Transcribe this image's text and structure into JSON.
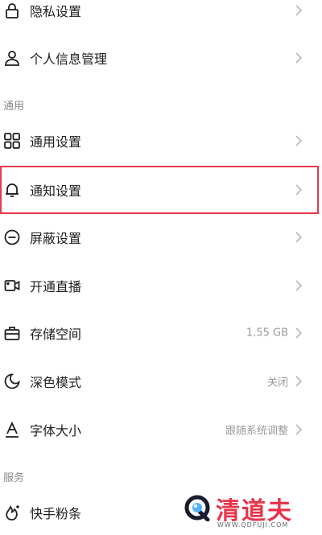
{
  "colors": {
    "highlight_border": "#e8384f",
    "text_primary": "#1f1f1f",
    "text_secondary": "#9a9a9a",
    "watermark_red": "#e8344a"
  },
  "sections": {
    "general_header": "通用",
    "services_header": "服务"
  },
  "items": {
    "privacy": {
      "label": "隐私设置",
      "icon": "lock-icon"
    },
    "personal_info": {
      "label": "个人信息管理",
      "icon": "person-icon"
    },
    "general": {
      "label": "通用设置",
      "icon": "grid-icon"
    },
    "notifications": {
      "label": "通知设置",
      "icon": "bell-icon"
    },
    "block": {
      "label": "屏蔽设置",
      "icon": "minus-circle-icon"
    },
    "live": {
      "label": "开通直播",
      "icon": "video-camera-icon"
    },
    "storage": {
      "label": "存储空间",
      "icon": "briefcase-icon",
      "value": "1.55 GB"
    },
    "dark_mode": {
      "label": "深色模式",
      "icon": "moon-icon",
      "value": "关闭"
    },
    "font_size": {
      "label": "字体大小",
      "icon": "font-icon",
      "value": "跟随系统调整"
    },
    "fans": {
      "label": "快手粉条",
      "icon": "fire-sparkle-icon"
    }
  },
  "watermark": {
    "title": "清道夫",
    "url": "WWW.QDFUJI.COM"
  }
}
